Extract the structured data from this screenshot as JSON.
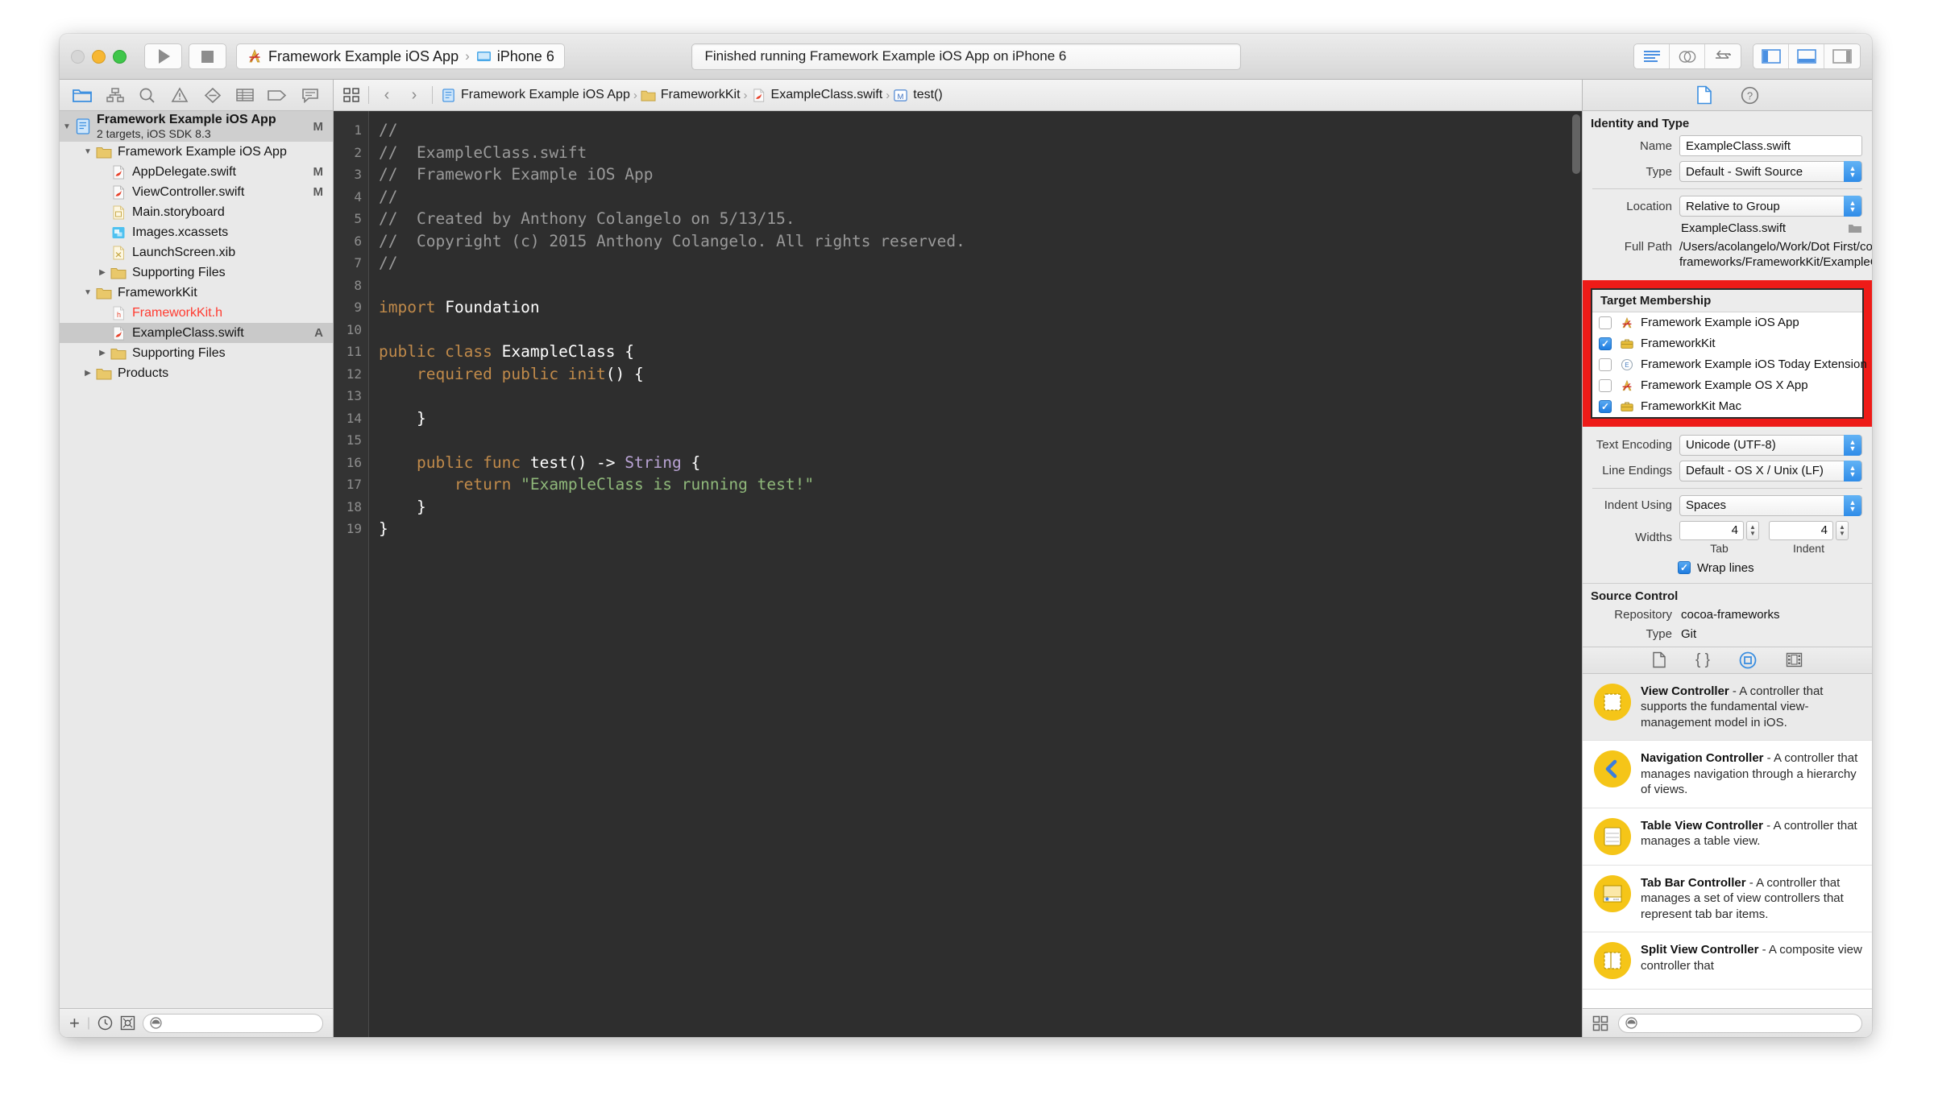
{
  "window": {
    "traffic_lights": [
      "close",
      "minimize",
      "zoom"
    ]
  },
  "toolbar": {
    "run_label": "Run",
    "stop_label": "Stop",
    "scheme_name": "Framework Example iOS App",
    "destination_name": "iPhone 6",
    "status_text": "Finished running Framework Example iOS App on iPhone 6",
    "editor_modes": [
      "standard-editor",
      "assistant-editor",
      "version-editor"
    ],
    "view_toggles": [
      "navigator-toggle",
      "debug-area-toggle",
      "utilities-toggle"
    ]
  },
  "navigator": {
    "tabs": [
      "project-navigator",
      "symbol-navigator",
      "find-navigator",
      "issue-navigator",
      "test-navigator",
      "debug-navigator",
      "breakpoint-navigator",
      "report-navigator"
    ],
    "active_tab": "project-navigator",
    "project": {
      "name": "Framework Example iOS App",
      "subtitle": "2 targets, iOS SDK 8.3",
      "status": "M"
    },
    "items": [
      {
        "label": "Framework Example iOS App",
        "icon": "folder",
        "depth": 1,
        "twisty": "open",
        "status": ""
      },
      {
        "label": "AppDelegate.swift",
        "icon": "swift",
        "depth": 2,
        "twisty": "none",
        "status": "M"
      },
      {
        "label": "ViewController.swift",
        "icon": "swift",
        "depth": 2,
        "twisty": "none",
        "status": "M"
      },
      {
        "label": "Main.storyboard",
        "icon": "storyboard",
        "depth": 2,
        "twisty": "none",
        "status": ""
      },
      {
        "label": "Images.xcassets",
        "icon": "xcassets",
        "depth": 2,
        "twisty": "none",
        "status": ""
      },
      {
        "label": "LaunchScreen.xib",
        "icon": "xib",
        "depth": 2,
        "twisty": "none",
        "status": ""
      },
      {
        "label": "Supporting Files",
        "icon": "folder",
        "depth": 2,
        "twisty": "closed",
        "status": ""
      },
      {
        "label": "FrameworkKit",
        "icon": "folder",
        "depth": 1,
        "twisty": "open",
        "status": ""
      },
      {
        "label": "FrameworkKit.h",
        "icon": "header",
        "depth": 2,
        "twisty": "none",
        "status": "",
        "color": "red"
      },
      {
        "label": "ExampleClass.swift",
        "icon": "swift",
        "depth": 2,
        "twisty": "none",
        "status": "A",
        "selected": true
      },
      {
        "label": "Supporting Files",
        "icon": "folder",
        "depth": 2,
        "twisty": "closed",
        "status": ""
      },
      {
        "label": "Products",
        "icon": "folder",
        "depth": 1,
        "twisty": "closed",
        "status": ""
      }
    ],
    "bottom_bar": {
      "add_label": "+",
      "buttons": [
        "recent-files-filter",
        "source-control-filter"
      ],
      "filter_placeholder": ""
    }
  },
  "jumpbar": {
    "related_items_icon": "related-items-icon",
    "back_label": "‹",
    "forward_label": "›",
    "breadcrumbs": [
      {
        "label": "Framework Example iOS App",
        "icon": "project"
      },
      {
        "label": "FrameworkKit",
        "icon": "folder"
      },
      {
        "label": "ExampleClass.swift",
        "icon": "swift"
      },
      {
        "label": "test()",
        "icon": "method"
      }
    ]
  },
  "editor": {
    "file_name": "ExampleClass.swift",
    "first_line": 1,
    "last_line": 19,
    "lines": [
      {
        "n": 1,
        "tokens": [
          {
            "t": "//",
            "c": "cmt"
          }
        ]
      },
      {
        "n": 2,
        "tokens": [
          {
            "t": "//  ExampleClass.swift",
            "c": "cmt"
          }
        ]
      },
      {
        "n": 3,
        "tokens": [
          {
            "t": "//  Framework Example iOS App",
            "c": "cmt"
          }
        ]
      },
      {
        "n": 4,
        "tokens": [
          {
            "t": "//",
            "c": "cmt"
          }
        ]
      },
      {
        "n": 5,
        "tokens": [
          {
            "t": "//  Created by Anthony Colangelo on 5/13/15.",
            "c": "cmt"
          }
        ]
      },
      {
        "n": 6,
        "tokens": [
          {
            "t": "//  Copyright (c) 2015 Anthony Colangelo. All rights reserved.",
            "c": "cmt"
          }
        ]
      },
      {
        "n": 7,
        "tokens": [
          {
            "t": "//",
            "c": "cmt"
          }
        ]
      },
      {
        "n": 8,
        "tokens": []
      },
      {
        "n": 9,
        "tokens": [
          {
            "t": "import",
            "c": "kw"
          },
          {
            "t": " ",
            "c": "plain"
          },
          {
            "t": "Foundation",
            "c": "id"
          }
        ]
      },
      {
        "n": 10,
        "tokens": []
      },
      {
        "n": 11,
        "tokens": [
          {
            "t": "public class",
            "c": "kw"
          },
          {
            "t": " ",
            "c": "plain"
          },
          {
            "t": "ExampleClass",
            "c": "id"
          },
          {
            "t": " {",
            "c": "plain"
          }
        ]
      },
      {
        "n": 12,
        "tokens": [
          {
            "t": "    ",
            "c": "plain"
          },
          {
            "t": "required public init",
            "c": "kw"
          },
          {
            "t": "() {",
            "c": "plain"
          }
        ]
      },
      {
        "n": 13,
        "tokens": []
      },
      {
        "n": 14,
        "tokens": [
          {
            "t": "    }",
            "c": "plain"
          }
        ]
      },
      {
        "n": 15,
        "tokens": []
      },
      {
        "n": 16,
        "tokens": [
          {
            "t": "    ",
            "c": "plain"
          },
          {
            "t": "public func",
            "c": "kw"
          },
          {
            "t": " ",
            "c": "plain"
          },
          {
            "t": "test",
            "c": "id"
          },
          {
            "t": "() -> ",
            "c": "plain"
          },
          {
            "t": "String",
            "c": "type"
          },
          {
            "t": " {",
            "c": "plain"
          }
        ]
      },
      {
        "n": 17,
        "tokens": [
          {
            "t": "        ",
            "c": "plain"
          },
          {
            "t": "return",
            "c": "kw"
          },
          {
            "t": " ",
            "c": "plain"
          },
          {
            "t": "\"ExampleClass is running test!\"",
            "c": "str"
          }
        ]
      },
      {
        "n": 18,
        "tokens": [
          {
            "t": "    }",
            "c": "plain"
          }
        ]
      },
      {
        "n": 19,
        "tokens": [
          {
            "t": "}",
            "c": "plain"
          }
        ]
      }
    ]
  },
  "inspector": {
    "tabs": [
      "file-inspector",
      "quick-help-inspector"
    ],
    "active_tab": "file-inspector",
    "identity_and_type": {
      "title": "Identity and Type",
      "name_label": "Name",
      "name_value": "ExampleClass.swift",
      "type_label": "Type",
      "type_value": "Default - Swift Source",
      "location_label": "Location",
      "location_value": "Relative to Group",
      "relative_file": "ExampleClass.swift",
      "full_path_label": "Full Path",
      "full_path_value": "/Users/acolangelo/Work/Dot First/cocoa-frameworks/FrameworkKit/ExampleClass.swift"
    },
    "target_membership": {
      "title": "Target Membership",
      "highlight_color": "#ee1b18",
      "targets": [
        {
          "label": "Framework Example iOS App",
          "checked": false,
          "icon": "ios-app"
        },
        {
          "label": "FrameworkKit",
          "checked": true,
          "icon": "framework"
        },
        {
          "label": "Framework Example iOS Today Extension",
          "checked": false,
          "icon": "extension"
        },
        {
          "label": "Framework Example OS X App",
          "checked": false,
          "icon": "osx-app"
        },
        {
          "label": "FrameworkKit Mac",
          "checked": true,
          "icon": "framework"
        }
      ]
    },
    "text_settings": {
      "text_encoding_label": "Text Encoding",
      "text_encoding_value": "Unicode (UTF-8)",
      "line_endings_label": "Line Endings",
      "line_endings_value": "Default - OS X / Unix (LF)",
      "indent_using_label": "Indent Using",
      "indent_using_value": "Spaces",
      "widths_label": "Widths",
      "tab_value": "4",
      "tab_caption": "Tab",
      "indent_value": "4",
      "indent_caption": "Indent",
      "wrap_lines_label": "Wrap lines",
      "wrap_lines_checked": true
    },
    "source_control": {
      "title": "Source Control",
      "repository_label": "Repository",
      "repository_value": "cocoa-frameworks",
      "type_label": "Type",
      "type_value": "Git"
    },
    "library_tabs": [
      "file-template-library",
      "code-snippet-library",
      "object-library",
      "media-library"
    ],
    "library_active_tab": "object-library",
    "library_items": [
      {
        "name": "View Controller",
        "desc": " - A controller that supports the fundamental view-management model in iOS.",
        "icon": "view-controller",
        "selected": true
      },
      {
        "name": "Navigation Controller",
        "desc": " - A controller that manages navigation through a hierarchy of views.",
        "icon": "navigation-controller",
        "selected": false
      },
      {
        "name": "Table View Controller",
        "desc": " - A controller that manages a table view.",
        "icon": "table-view-controller",
        "selected": false
      },
      {
        "name": "Tab Bar Controller",
        "desc": " - A controller that manages a set of view controllers that represent tab bar items.",
        "icon": "tab-bar-controller",
        "selected": false
      },
      {
        "name": "Split View Controller",
        "desc": " - A composite view controller that",
        "icon": "split-view-controller",
        "selected": false
      }
    ],
    "bottom_bar": {
      "filter_placeholder": ""
    }
  }
}
